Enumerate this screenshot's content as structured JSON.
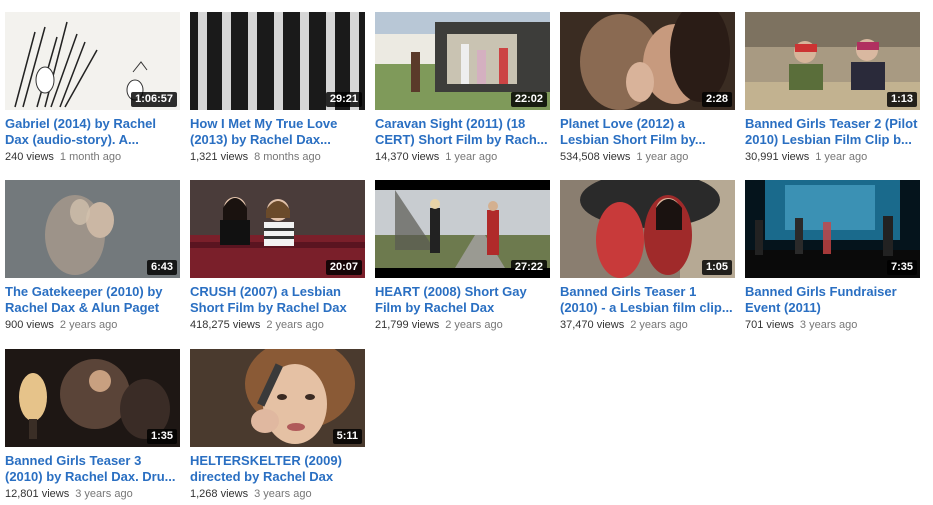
{
  "videos": [
    {
      "title": "Gabriel (2014) by Rachel Dax (audio-story). A...",
      "duration": "1:06:57",
      "views": "240 views",
      "age": "1 month ago"
    },
    {
      "title": "How I Met My True Love (2013) by Rachel Dax...",
      "duration": "29:21",
      "views": "1,321 views",
      "age": "8 months ago"
    },
    {
      "title": "Caravan Sight (2011) (18 CERT) Short Film by Rach...",
      "duration": "22:02",
      "views": "14,370 views",
      "age": "1 year ago"
    },
    {
      "title": "Planet Love (2012) a Lesbian Short Film by...",
      "duration": "2:28",
      "views": "534,508 views",
      "age": "1 year ago"
    },
    {
      "title": "Banned Girls Teaser 2 (Pilot 2010) Lesbian Film Clip b...",
      "duration": "1:13",
      "views": "30,991 views",
      "age": "1 year ago"
    },
    {
      "title": "The Gatekeeper (2010) by Rachel Dax & Alun Paget",
      "duration": "6:43",
      "views": "900 views",
      "age": "2 years ago"
    },
    {
      "title": "CRUSH (2007) a Lesbian Short Film by Rachel Dax",
      "duration": "20:07",
      "views": "418,275 views",
      "age": "2 years ago"
    },
    {
      "title": "HEART (2008) Short Gay Film by Rachel Dax",
      "duration": "27:22",
      "views": "21,799 views",
      "age": "2 years ago"
    },
    {
      "title": "Banned Girls Teaser 1 (2010) - a Lesbian film clip...",
      "duration": "1:05",
      "views": "37,470 views",
      "age": "2 years ago"
    },
    {
      "title": "Banned Girls Fundraiser Event (2011)",
      "duration": "7:35",
      "views": "701 views",
      "age": "3 years ago"
    },
    {
      "title": "Banned Girls Teaser 3 (2010) by Rachel Dax. Dru...",
      "duration": "1:35",
      "views": "12,801 views",
      "age": "3 years ago"
    },
    {
      "title": "HELTERSKELTER (2009) directed by Rachel Dax",
      "duration": "5:11",
      "views": "1,268 views",
      "age": "3 years ago"
    }
  ]
}
